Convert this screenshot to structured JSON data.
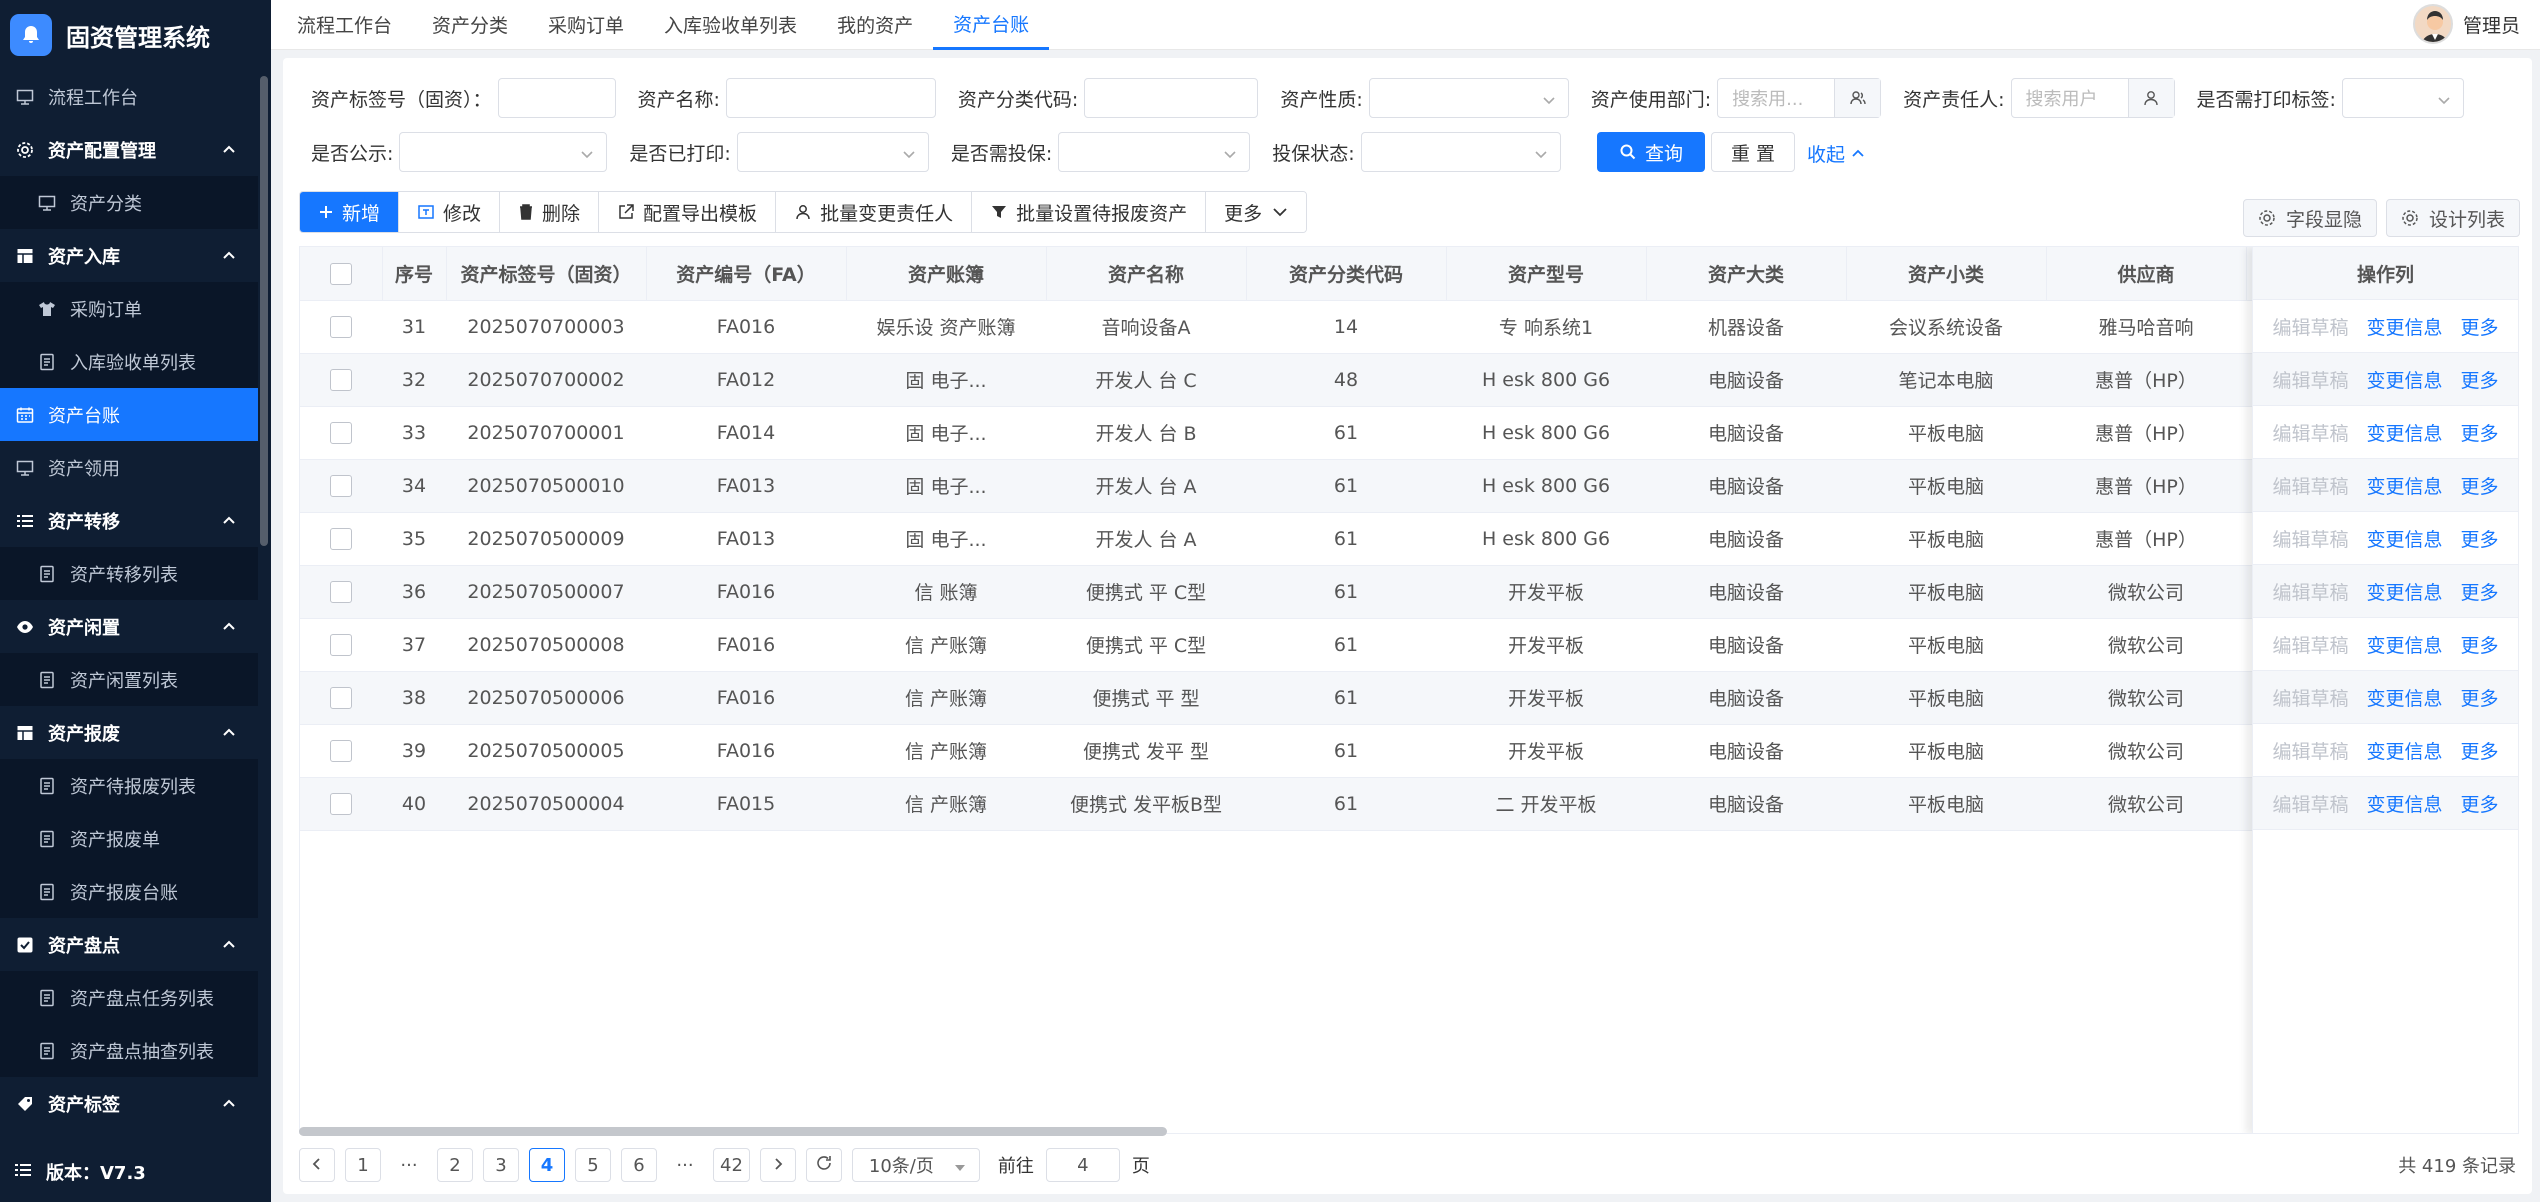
{
  "app": {
    "title": "固资管理系统",
    "version": "版本：V7.3"
  },
  "sidebar": {
    "items": [
      {
        "label": "流程工作台",
        "kind": "top",
        "icon": "monitor-icon"
      },
      {
        "label": "资产配置管理",
        "kind": "group",
        "icon": "gear-icon"
      },
      {
        "label": "资产分类",
        "kind": "sub",
        "icon": "monitor-icon"
      },
      {
        "label": "资产入库",
        "kind": "group",
        "icon": "table-icon"
      },
      {
        "label": "采购订单",
        "kind": "sub",
        "icon": "shirt-icon"
      },
      {
        "label": "入库验收单列表",
        "kind": "sub",
        "icon": "doc-icon"
      },
      {
        "label": "资产台账",
        "kind": "active",
        "icon": "calendar-icon"
      },
      {
        "label": "资产领用",
        "kind": "top",
        "icon": "monitor-icon"
      },
      {
        "label": "资产转移",
        "kind": "group",
        "icon": "list-icon"
      },
      {
        "label": "资产转移列表",
        "kind": "sub",
        "icon": "doc-icon"
      },
      {
        "label": "资产闲置",
        "kind": "group",
        "icon": "eye-icon"
      },
      {
        "label": "资产闲置列表",
        "kind": "sub",
        "icon": "doc-icon"
      },
      {
        "label": "资产报废",
        "kind": "group",
        "icon": "table-icon"
      },
      {
        "label": "资产待报废列表",
        "kind": "sub",
        "icon": "doc-icon"
      },
      {
        "label": "资产报废单",
        "kind": "sub",
        "icon": "doc-icon"
      },
      {
        "label": "资产报废台账",
        "kind": "sub",
        "icon": "doc-icon"
      },
      {
        "label": "资产盘点",
        "kind": "group",
        "icon": "check-icon"
      },
      {
        "label": "资产盘点任务列表",
        "kind": "sub",
        "icon": "doc-icon"
      },
      {
        "label": "资产盘点抽查列表",
        "kind": "sub",
        "icon": "doc-icon"
      },
      {
        "label": "资产标签",
        "kind": "group",
        "icon": "tag-icon"
      }
    ]
  },
  "topnav": {
    "tabs": [
      "流程工作台",
      "资产分类",
      "采购订单",
      "入库验收单列表",
      "我的资产",
      "资产台账"
    ],
    "active_index": 5,
    "user_name": "管理员"
  },
  "filters": {
    "row1": [
      {
        "label": "资产标签号（固资）：",
        "placeholder": ""
      },
      {
        "label": "资产名称:",
        "placeholder": ""
      },
      {
        "label": "资产分类代码:",
        "placeholder": ""
      },
      {
        "label": "资产性质:",
        "placeholder": ""
      },
      {
        "label": "资产使用部门:",
        "placeholder": "搜索用..."
      },
      {
        "label": "资产责任人:",
        "placeholder": "搜索用户"
      },
      {
        "label": "是否需打印标签:",
        "placeholder": ""
      }
    ],
    "row2": [
      {
        "label": "是否公示:",
        "placeholder": ""
      },
      {
        "label": "是否已打印:",
        "placeholder": ""
      },
      {
        "label": "是否需投保:",
        "placeholder": ""
      },
      {
        "label": "投保状态:",
        "placeholder": ""
      }
    ],
    "search_label": "查询",
    "reset_label": "重 置",
    "collapse_label": "收起"
  },
  "toolbar": {
    "buttons": [
      "新增",
      "修改",
      "删除",
      "配置导出模板",
      "批量变更责任人",
      "批量设置待报废资产",
      "更多"
    ],
    "field_toggle": "字段显隐",
    "design_list": "设计列表"
  },
  "table": {
    "columns": [
      "序号",
      "资产标签号（固资）",
      "资产编号（FA）",
      "资产账簿",
      "资产名称",
      "资产分类代码",
      "资产型号",
      "资产大类",
      "资产小类",
      "供应商"
    ],
    "op_column": "操作列",
    "op_actions": [
      "编辑草稿",
      "变更信息",
      "更多"
    ],
    "rows": [
      [
        "31",
        "2025070700003",
        "FA016",
        "娱乐设 资产账簿",
        "音响设备A",
        "14",
        "专 响系统1",
        "机器设备",
        "会议系统设备",
        "雅马哈音响"
      ],
      [
        "32",
        "2025070700002",
        "FA012",
        "固 电子...",
        "开发人 台 C",
        "48",
        "H esk 800 G6",
        "电脑设备",
        "笔记本电脑",
        "惠普（HP）"
      ],
      [
        "33",
        "2025070700001",
        "FA014",
        "固 电子...",
        "开发人 台 B",
        "61",
        "H esk 800 G6",
        "电脑设备",
        "平板电脑",
        "惠普（HP）"
      ],
      [
        "34",
        "2025070500010",
        "FA013",
        "固 电子...",
        "开发人 台 A",
        "61",
        "H esk 800 G6",
        "电脑设备",
        "平板电脑",
        "惠普（HP）"
      ],
      [
        "35",
        "2025070500009",
        "FA013",
        "固 电子...",
        "开发人 台 A",
        "61",
        "H esk 800 G6",
        "电脑设备",
        "平板电脑",
        "惠普（HP）"
      ],
      [
        "36",
        "2025070500007",
        "FA016",
        "信 账簿",
        "便携式 平 C型",
        "61",
        "开发平板",
        "电脑设备",
        "平板电脑",
        "微软公司"
      ],
      [
        "37",
        "2025070500008",
        "FA016",
        "信 产账簿",
        "便携式 平 C型",
        "61",
        "开发平板",
        "电脑设备",
        "平板电脑",
        "微软公司"
      ],
      [
        "38",
        "2025070500006",
        "FA016",
        "信 产账簿",
        "便携式 平 型",
        "61",
        "开发平板",
        "电脑设备",
        "平板电脑",
        "微软公司"
      ],
      [
        "39",
        "2025070500005",
        "FA016",
        "信 产账簿",
        "便携式 发平 型",
        "61",
        "开发平板",
        "电脑设备",
        "平板电脑",
        "微软公司"
      ],
      [
        "40",
        "2025070500004",
        "FA015",
        "信 产账簿",
        "便携式 发平板B型",
        "61",
        "二 开发平板",
        "电脑设备",
        "平板电脑",
        "微软公司"
      ]
    ]
  },
  "pagination": {
    "pages": [
      "1",
      "···",
      "2",
      "3",
      "4",
      "5",
      "6",
      "···",
      "42"
    ],
    "current": "4",
    "page_size": "10条/页",
    "goto_prefix": "前往",
    "goto_value": "4",
    "goto_suffix": "页",
    "total": "共 419 条记录"
  },
  "colors": {
    "primary": "#1677ff",
    "sidebar": "#0f1e33"
  }
}
